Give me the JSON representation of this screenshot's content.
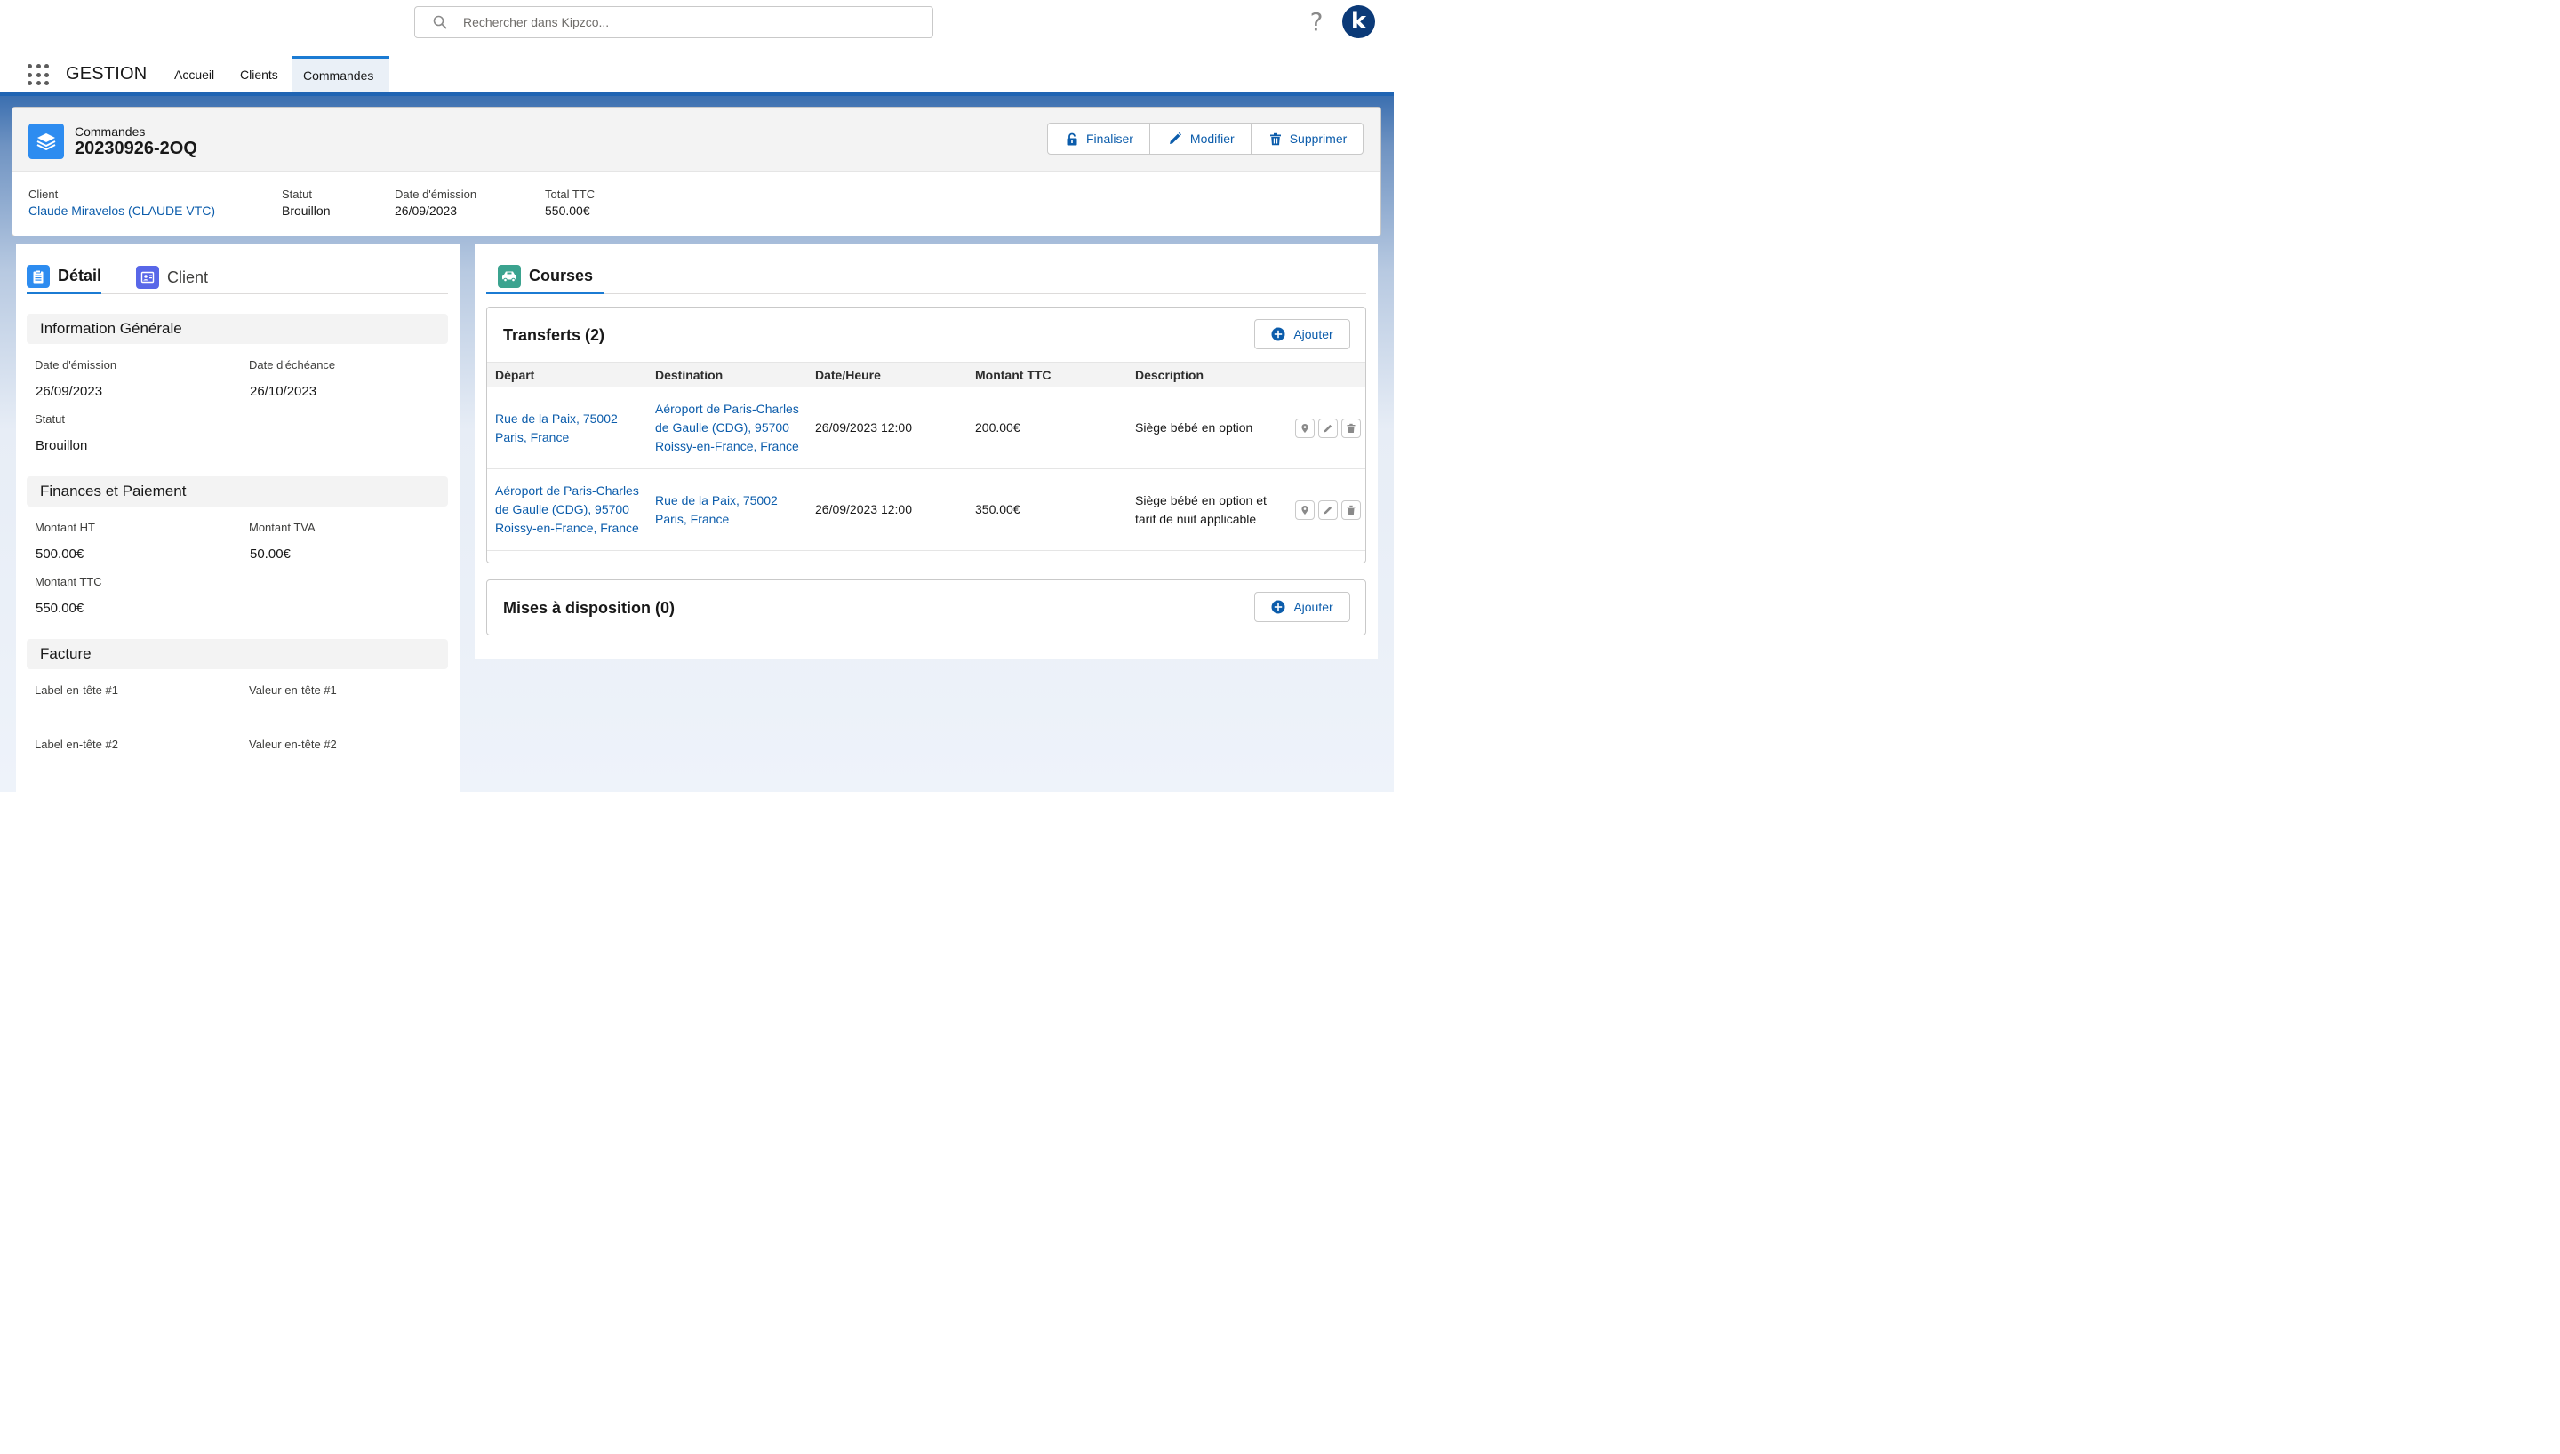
{
  "header": {
    "search_placeholder": "Rechercher dans Kipzco...",
    "help_glyph": "?",
    "avatar_letter": "k"
  },
  "nav": {
    "app_name": "GESTION",
    "tabs": [
      {
        "label": "Accueil",
        "active": false
      },
      {
        "label": "Clients",
        "active": false
      },
      {
        "label": "Commandes",
        "active": true
      }
    ]
  },
  "record": {
    "type_label": "Commandes",
    "title": "20230926-2OQ",
    "actions": {
      "finalize": "Finaliser",
      "edit": "Modifier",
      "delete": "Supprimer"
    },
    "fields": {
      "client_label": "Client",
      "client_value": "Claude Miravelos (CLAUDE VTC)",
      "status_label": "Statut",
      "status_value": "Brouillon",
      "issue_date_label": "Date d'émission",
      "issue_date_value": "26/09/2023",
      "total_label": "Total TTC",
      "total_value": "550.00€"
    }
  },
  "left_tabs": {
    "detail": "Détail",
    "client": "Client"
  },
  "sections": {
    "general": {
      "title": "Information Générale",
      "issue_date_label": "Date d'émission",
      "issue_date_value": "26/09/2023",
      "due_date_label": "Date d'échéance",
      "due_date_value": "26/10/2023",
      "status_label": "Statut",
      "status_value": "Brouillon"
    },
    "finance": {
      "title": "Finances et Paiement",
      "ht_label": "Montant HT",
      "ht_value": "500.00€",
      "tva_label": "Montant TVA",
      "tva_value": "50.00€",
      "ttc_label": "Montant TTC",
      "ttc_value": "550.00€"
    },
    "invoice": {
      "title": "Facture",
      "label1": "Label en-tête #1",
      "value1": "Valeur en-tête #1",
      "label2": "Label en-tête #2",
      "value2": "Valeur en-tête #2"
    }
  },
  "courses": {
    "tab_label": "Courses",
    "transfers": {
      "title": "Transferts (2)",
      "add_label": "Ajouter",
      "columns": [
        "Départ",
        "Destination",
        "Date/Heure",
        "Montant TTC",
        "Description"
      ],
      "rows": [
        {
          "depart": "Rue de la Paix, 75002 Paris, France",
          "destination": "Aéroport de Paris-Charles de Gaulle (CDG), 95700 Roissy-en-France, France",
          "datetime": "26/09/2023 12:00",
          "amount": "200.00€",
          "description": "Siège bébé en option"
        },
        {
          "depart": "Aéroport de Paris-Charles de Gaulle (CDG), 95700 Roissy-en-France, France",
          "destination": "Rue de la Paix, 75002 Paris, France",
          "datetime": "26/09/2023 12:00",
          "amount": "350.00€",
          "description": "Siège bébé en option et tarif de nuit applicable"
        }
      ]
    },
    "disposals": {
      "title": "Mises à disposition (0)",
      "add_label": "Ajouter"
    }
  },
  "colors": {
    "accent": "#1b7bd3",
    "link": "#0b5cab",
    "record_icon": "#2d8cf0",
    "detail_icon": "#2d8cf0",
    "client_icon": "#5867e8",
    "courses_icon": "#3ba38f",
    "avatar": "#0b3a78"
  }
}
